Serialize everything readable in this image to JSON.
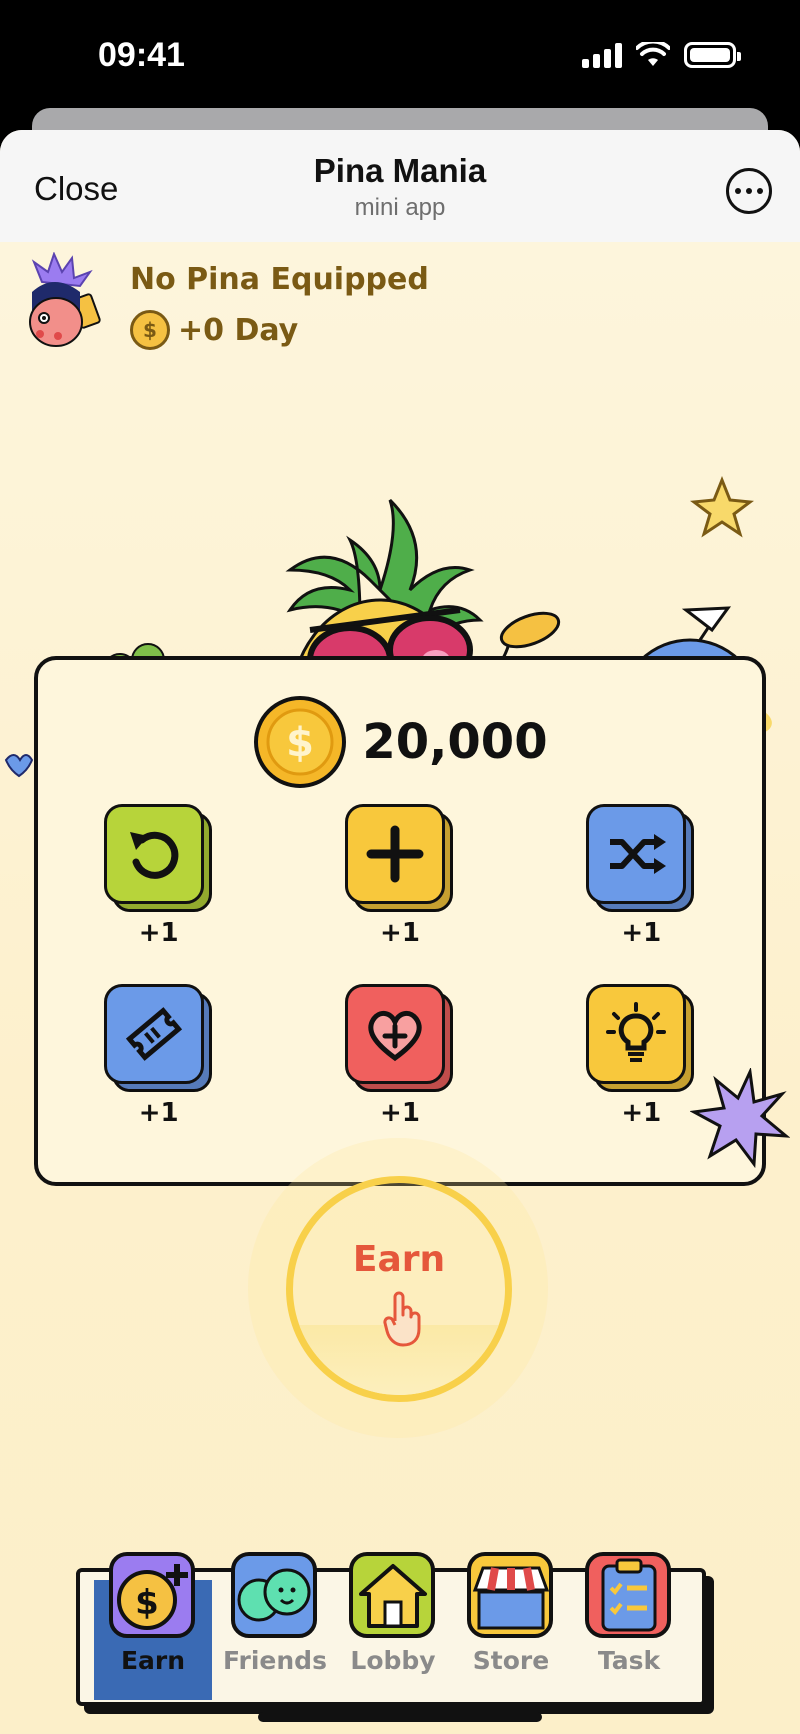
{
  "status_bar": {
    "time": "09:41"
  },
  "header": {
    "close_label": "Close",
    "title": "Pina Mania",
    "subtitle": "mini app"
  },
  "profile": {
    "equipped_text": "No Pina Equipped",
    "day_reward": "+0 Day"
  },
  "balance": {
    "value": "20,000"
  },
  "boosters": [
    {
      "icon": "undo-icon",
      "count": "+1",
      "color": "#b7d43a"
    },
    {
      "icon": "plus-icon",
      "count": "+1",
      "color": "#f8c83c"
    },
    {
      "icon": "shuffle-icon",
      "count": "+1",
      "color": "#6b9ae8"
    },
    {
      "icon": "ticket-icon",
      "count": "+1",
      "color": "#6b9ae8"
    },
    {
      "icon": "heart-plus-icon",
      "count": "+1",
      "color": "#f0605e"
    },
    {
      "icon": "lightbulb-icon",
      "count": "+1",
      "color": "#f8c83c"
    }
  ],
  "earn_button": {
    "label": "Earn"
  },
  "nav": {
    "active": "Earn",
    "items": [
      {
        "label": "Earn",
        "icon": "coin-plus-icon"
      },
      {
        "label": "Friends",
        "icon": "friends-icon"
      },
      {
        "label": "Lobby",
        "icon": "house-icon"
      },
      {
        "label": "Store",
        "icon": "store-icon"
      },
      {
        "label": "Task",
        "icon": "clipboard-icon"
      }
    ]
  },
  "colors": {
    "accent": "#f8d04a",
    "text_brown": "#7a5a14",
    "earn_red": "#e5573b",
    "nav_active": "#3a6ab4"
  }
}
